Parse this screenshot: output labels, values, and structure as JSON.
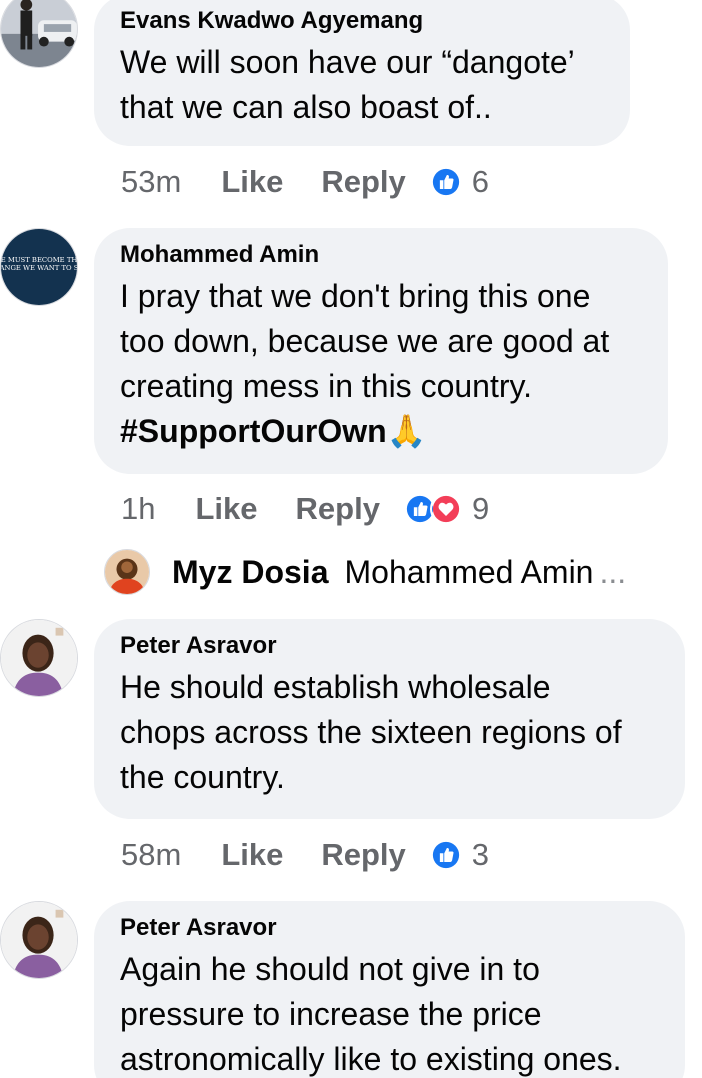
{
  "comments": [
    {
      "author": "Evans Kwadwo Agyemang",
      "lines": [
        "We will soon have our “dangote’",
        "that we can also boast of.."
      ],
      "time": "53m",
      "like": "Like",
      "reply": "Reply",
      "reaction_count": "6"
    },
    {
      "author": "Mohammed Amin",
      "avatar_text": [
        "E MUST BECOME TH",
        "ANGE WE WANT TO S"
      ],
      "lines": [
        "I pray that we don't bring this one",
        "too  down, because we are good at",
        "creating mess in this country."
      ],
      "hashtag": "#SupportOurOwn",
      "emoji": "🙏",
      "time": "1h",
      "like": "Like",
      "reply": "Reply",
      "reaction_count": "9"
    },
    {
      "author": "Peter Asravor",
      "lines": [
        "He should establish wholesale",
        "chops across the sixteen regions of",
        "the country."
      ],
      "time": "58m",
      "like": "Like",
      "reply": "Reply",
      "reaction_count": "3"
    },
    {
      "author": "Peter Asravor",
      "lines": [
        "Again he should not give in to",
        "pressure to increase the price",
        "astronomically like to existing ones."
      ]
    }
  ],
  "reply_preview": {
    "author": "Myz Dosia",
    "snippet": "Mohammed Amin",
    "ellipsis": "..."
  },
  "colors": {
    "bubble": "#f0f2f5",
    "meta_text": "#65676b",
    "like_blue": "#1877f2",
    "love_red": "#f33e58"
  },
  "icons": [
    "like-reaction-icon",
    "love-reaction-icon",
    "folded-hands-emoji"
  ]
}
